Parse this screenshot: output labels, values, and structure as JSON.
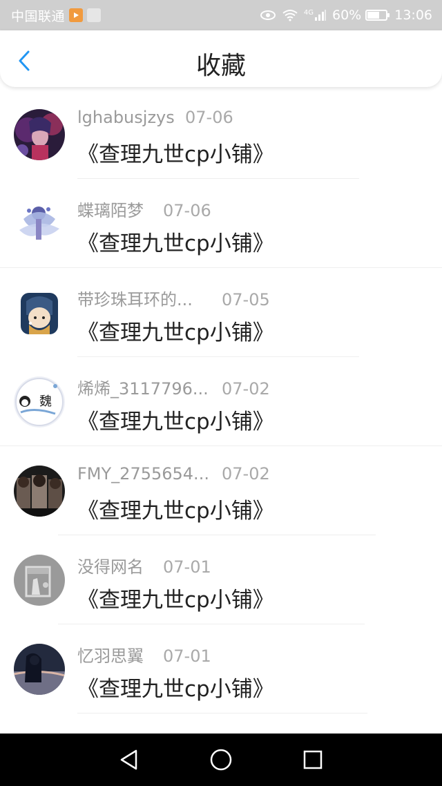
{
  "status_bar": {
    "carrier": "中国联通",
    "network": "4G",
    "battery": "60%",
    "time": "13:06"
  },
  "header": {
    "title": "收藏",
    "back_icon": "chevron-left-icon"
  },
  "items": [
    {
      "username": "lghabusjzys",
      "date": "07-06",
      "title": "《查理九世cp小铺》"
    },
    {
      "username": "蝶璃陌梦",
      "date": "07-06",
      "title": "《查理九世cp小铺》"
    },
    {
      "username": "带珍珠耳环的...",
      "date": "07-05",
      "title": "《查理九世cp小铺》"
    },
    {
      "username": "烯烯_3117796...",
      "date": "07-02",
      "title": "《查理九世cp小铺》"
    },
    {
      "username": "FMY_2755654...",
      "date": "07-02",
      "title": "《查理九世cp小铺》"
    },
    {
      "username": "没得网名",
      "date": "07-01",
      "title": "《查理九世cp小铺》"
    },
    {
      "username": "忆羽思翼",
      "date": "07-01",
      "title": "《查理九世cp小铺》"
    }
  ],
  "avatar_badge": "魏",
  "colors": {
    "accent": "#2196f3",
    "status_bar": "#cfcfcf",
    "nav_bar": "#000000"
  },
  "nav": {
    "back": "triangle-back-icon",
    "home": "circle-home-icon",
    "recents": "square-recents-icon"
  }
}
